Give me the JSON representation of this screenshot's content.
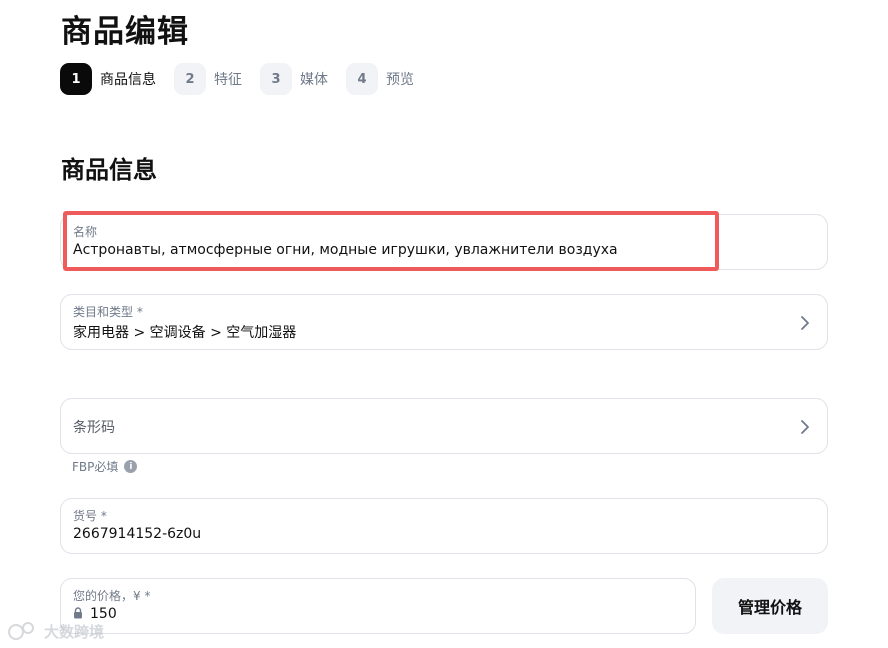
{
  "page": {
    "title": "商品编辑"
  },
  "steps": [
    {
      "num": "1",
      "label": "商品信息"
    },
    {
      "num": "2",
      "label": "特征"
    },
    {
      "num": "3",
      "label": "媒体"
    },
    {
      "num": "4",
      "label": "预览"
    }
  ],
  "section": {
    "title": "商品信息"
  },
  "fields": {
    "name": {
      "label": "名称",
      "value": "Астронавты, атмосферные огни, модные игрушки, увлажнители воздуха"
    },
    "category": {
      "label": "类目和类型 *",
      "value": "家用电器 > 空调设备 > 空气加湿器"
    },
    "barcode": {
      "label": "条形码",
      "hint": "FBP必填"
    },
    "sku": {
      "label": "货号 *",
      "value": "2667914152-6z0u"
    },
    "price": {
      "label": "您的价格，¥ *",
      "value": "150"
    }
  },
  "buttons": {
    "manage_price": "管理价格"
  },
  "watermark": {
    "text": "大数跨境"
  },
  "colors": {
    "accent_step": "#0a0a0a",
    "highlight": "#ef5a5a",
    "border": "#dfe2e8"
  }
}
